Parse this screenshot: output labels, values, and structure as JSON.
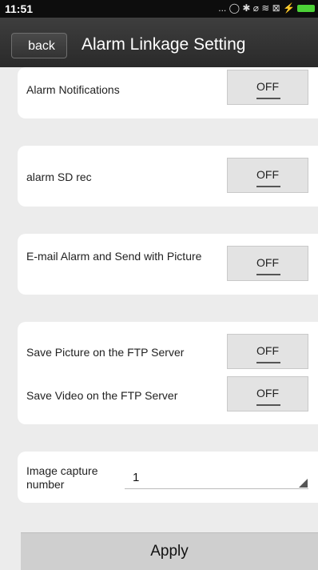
{
  "status_bar": {
    "time": "11:51",
    "icons": "... ◯ ✱ ⌀ ≋ ⊠ ⚡"
  },
  "header": {
    "back_label": "back",
    "title": "Alarm Linkage Setting"
  },
  "settings": {
    "alarm_notifications": {
      "label": "Alarm Notifications",
      "value": "OFF"
    },
    "alarm_sd_rec": {
      "label": "alarm SD rec",
      "value": "OFF"
    },
    "email_alarm": {
      "label": "E-mail Alarm and Send with Picture",
      "value": "OFF"
    },
    "ftp_picture": {
      "label": "Save Picture on the FTP Server",
      "value": "OFF"
    },
    "ftp_video": {
      "label": "Save Video on the FTP Server",
      "value": "OFF"
    },
    "image_capture": {
      "label": "Image capture number",
      "value": "1"
    }
  },
  "apply_label": "Apply"
}
